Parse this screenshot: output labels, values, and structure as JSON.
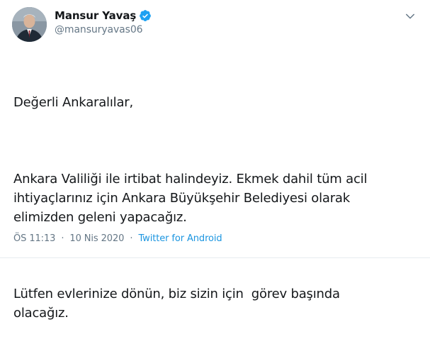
{
  "author": {
    "display_name": "Mansur Yavaş",
    "handle": "@mansuryavas06",
    "verified": true,
    "avatar_icon": "profile-photo"
  },
  "menu": {
    "icon": "chevron-down-icon"
  },
  "tweet": {
    "paragraphs": [
      "Değerli Ankaralılar,",
      "Ankara Valiliği ile irtibat halindeyiz. Ekmek dahil tüm acil\nihtiyaçlarınız için Ankara Büyükşehir Belediyesi olarak\nelimizden geleni yapacağız.",
      "Lütfen evlerinize dönün, biz sizin için  görev başında\nolacağız."
    ]
  },
  "meta": {
    "time": "ÖS 11:13",
    "separator": "·",
    "date": "10 Nis 2020",
    "source": "Twitter for Android"
  },
  "colors": {
    "verified": "#1da1f2",
    "link": "#1b95e0",
    "secondary_text": "#657786"
  }
}
